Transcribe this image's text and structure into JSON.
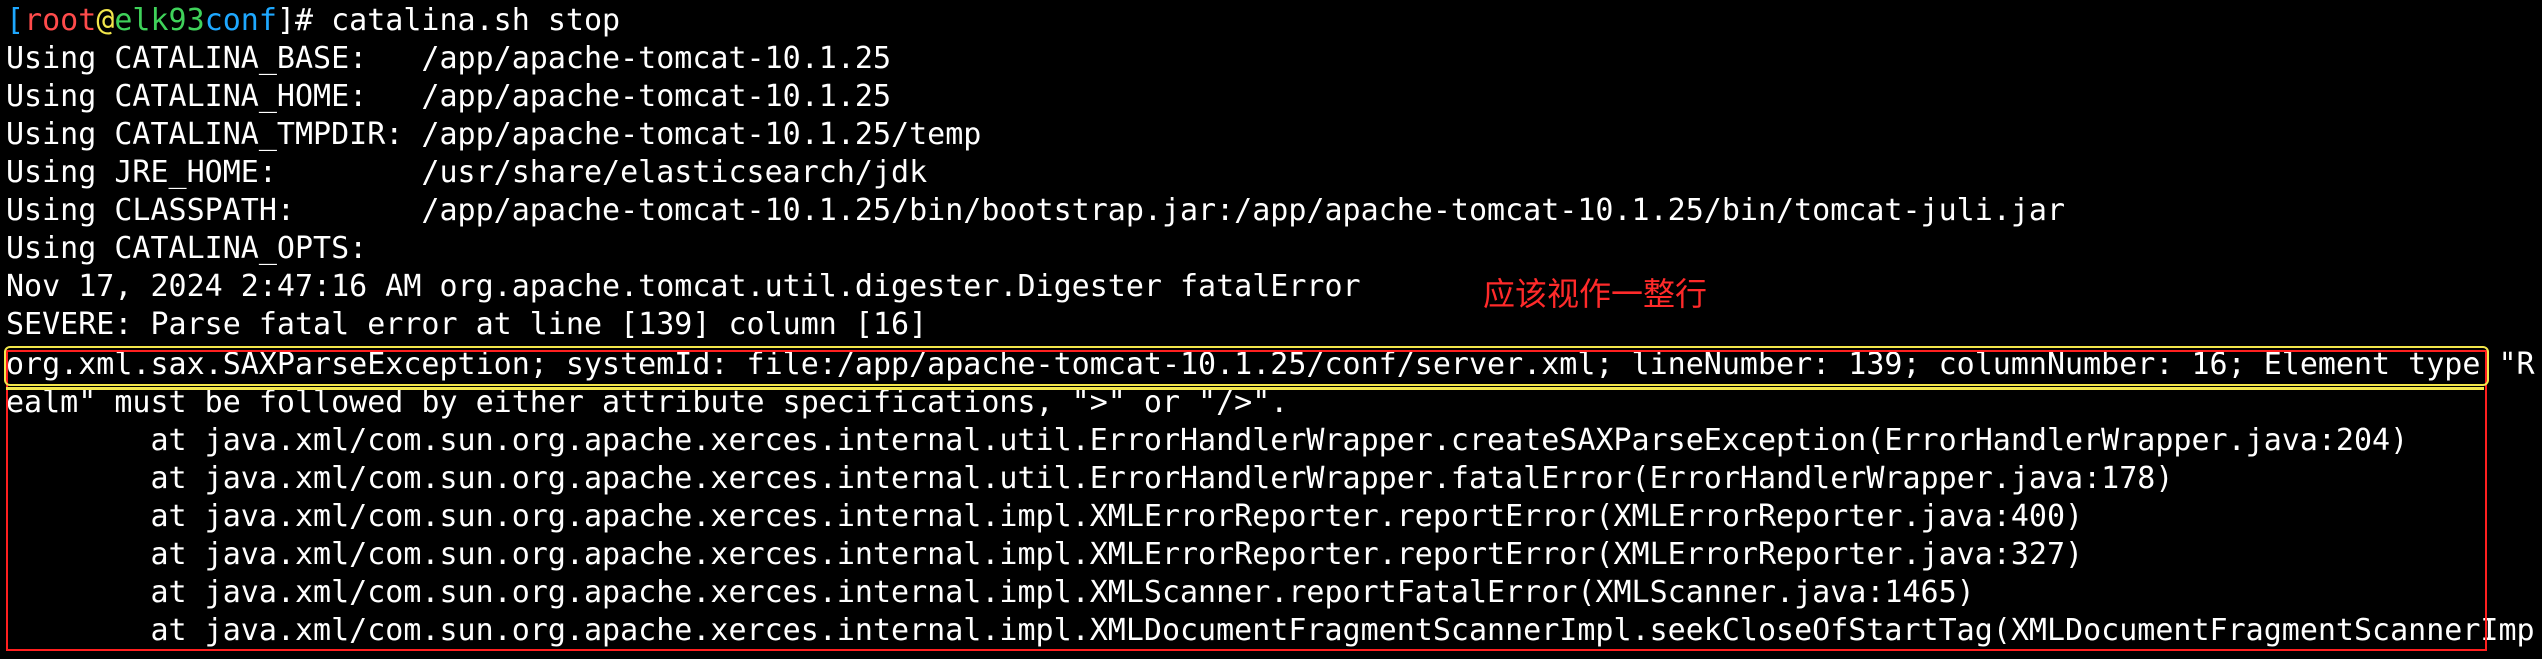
{
  "terminal": {
    "prompt": {
      "open_bracket": "[",
      "user": "root",
      "at": "@",
      "host": "elk93",
      "dir": "conf",
      "close": "]# ",
      "command": "catalina.sh stop"
    },
    "lines": [
      "Using CATALINA_BASE:   /app/apache-tomcat-10.1.25",
      "Using CATALINA_HOME:   /app/apache-tomcat-10.1.25",
      "Using CATALINA_TMPDIR: /app/apache-tomcat-10.1.25/temp",
      "Using JRE_HOME:        /usr/share/elasticsearch/jdk",
      "Using CLASSPATH:       /app/apache-tomcat-10.1.25/bin/bootstrap.jar:/app/apache-tomcat-10.1.25/bin/tomcat-juli.jar",
      "Using CATALINA_OPTS:",
      "Nov 17, 2024 2:47:16 AM org.apache.tomcat.util.digester.Digester fatalError",
      "SEVERE: Parse fatal error at line [139] column [16]",
      "org.xml.sax.SAXParseException; systemId: file:/app/apache-tomcat-10.1.25/conf/server.xml; lineNumber: 139; columnNumber: 16; Element type \"R",
      "ealm\" must be followed by either attribute specifications, \">\" or \"/>\".",
      "        at java.xml/com.sun.org.apache.xerces.internal.util.ErrorHandlerWrapper.createSAXParseException(ErrorHandlerWrapper.java:204)",
      "        at java.xml/com.sun.org.apache.xerces.internal.util.ErrorHandlerWrapper.fatalError(ErrorHandlerWrapper.java:178)",
      "        at java.xml/com.sun.org.apache.xerces.internal.impl.XMLErrorReporter.reportError(XMLErrorReporter.java:400)",
      "        at java.xml/com.sun.org.apache.xerces.internal.impl.XMLErrorReporter.reportError(XMLErrorReporter.java:327)",
      "        at java.xml/com.sun.org.apache.xerces.internal.impl.XMLScanner.reportFatalError(XMLScanner.java:1465)",
      "        at java.xml/com.sun.org.apache.xerces.internal.impl.XMLDocumentFragmentScannerImpl.seekCloseOfStartTag(XMLDocumentFragmentScannerImp"
    ]
  },
  "annotation": {
    "note": "应该视作一整行"
  },
  "colors": {
    "background": "#000000",
    "text": "#ffffff",
    "bracket": "#1ea8ff",
    "user": "#ff4b4b",
    "host": "#3fd25a",
    "annotation": "#ff2a2a",
    "highlight": "#f2e64b"
  }
}
